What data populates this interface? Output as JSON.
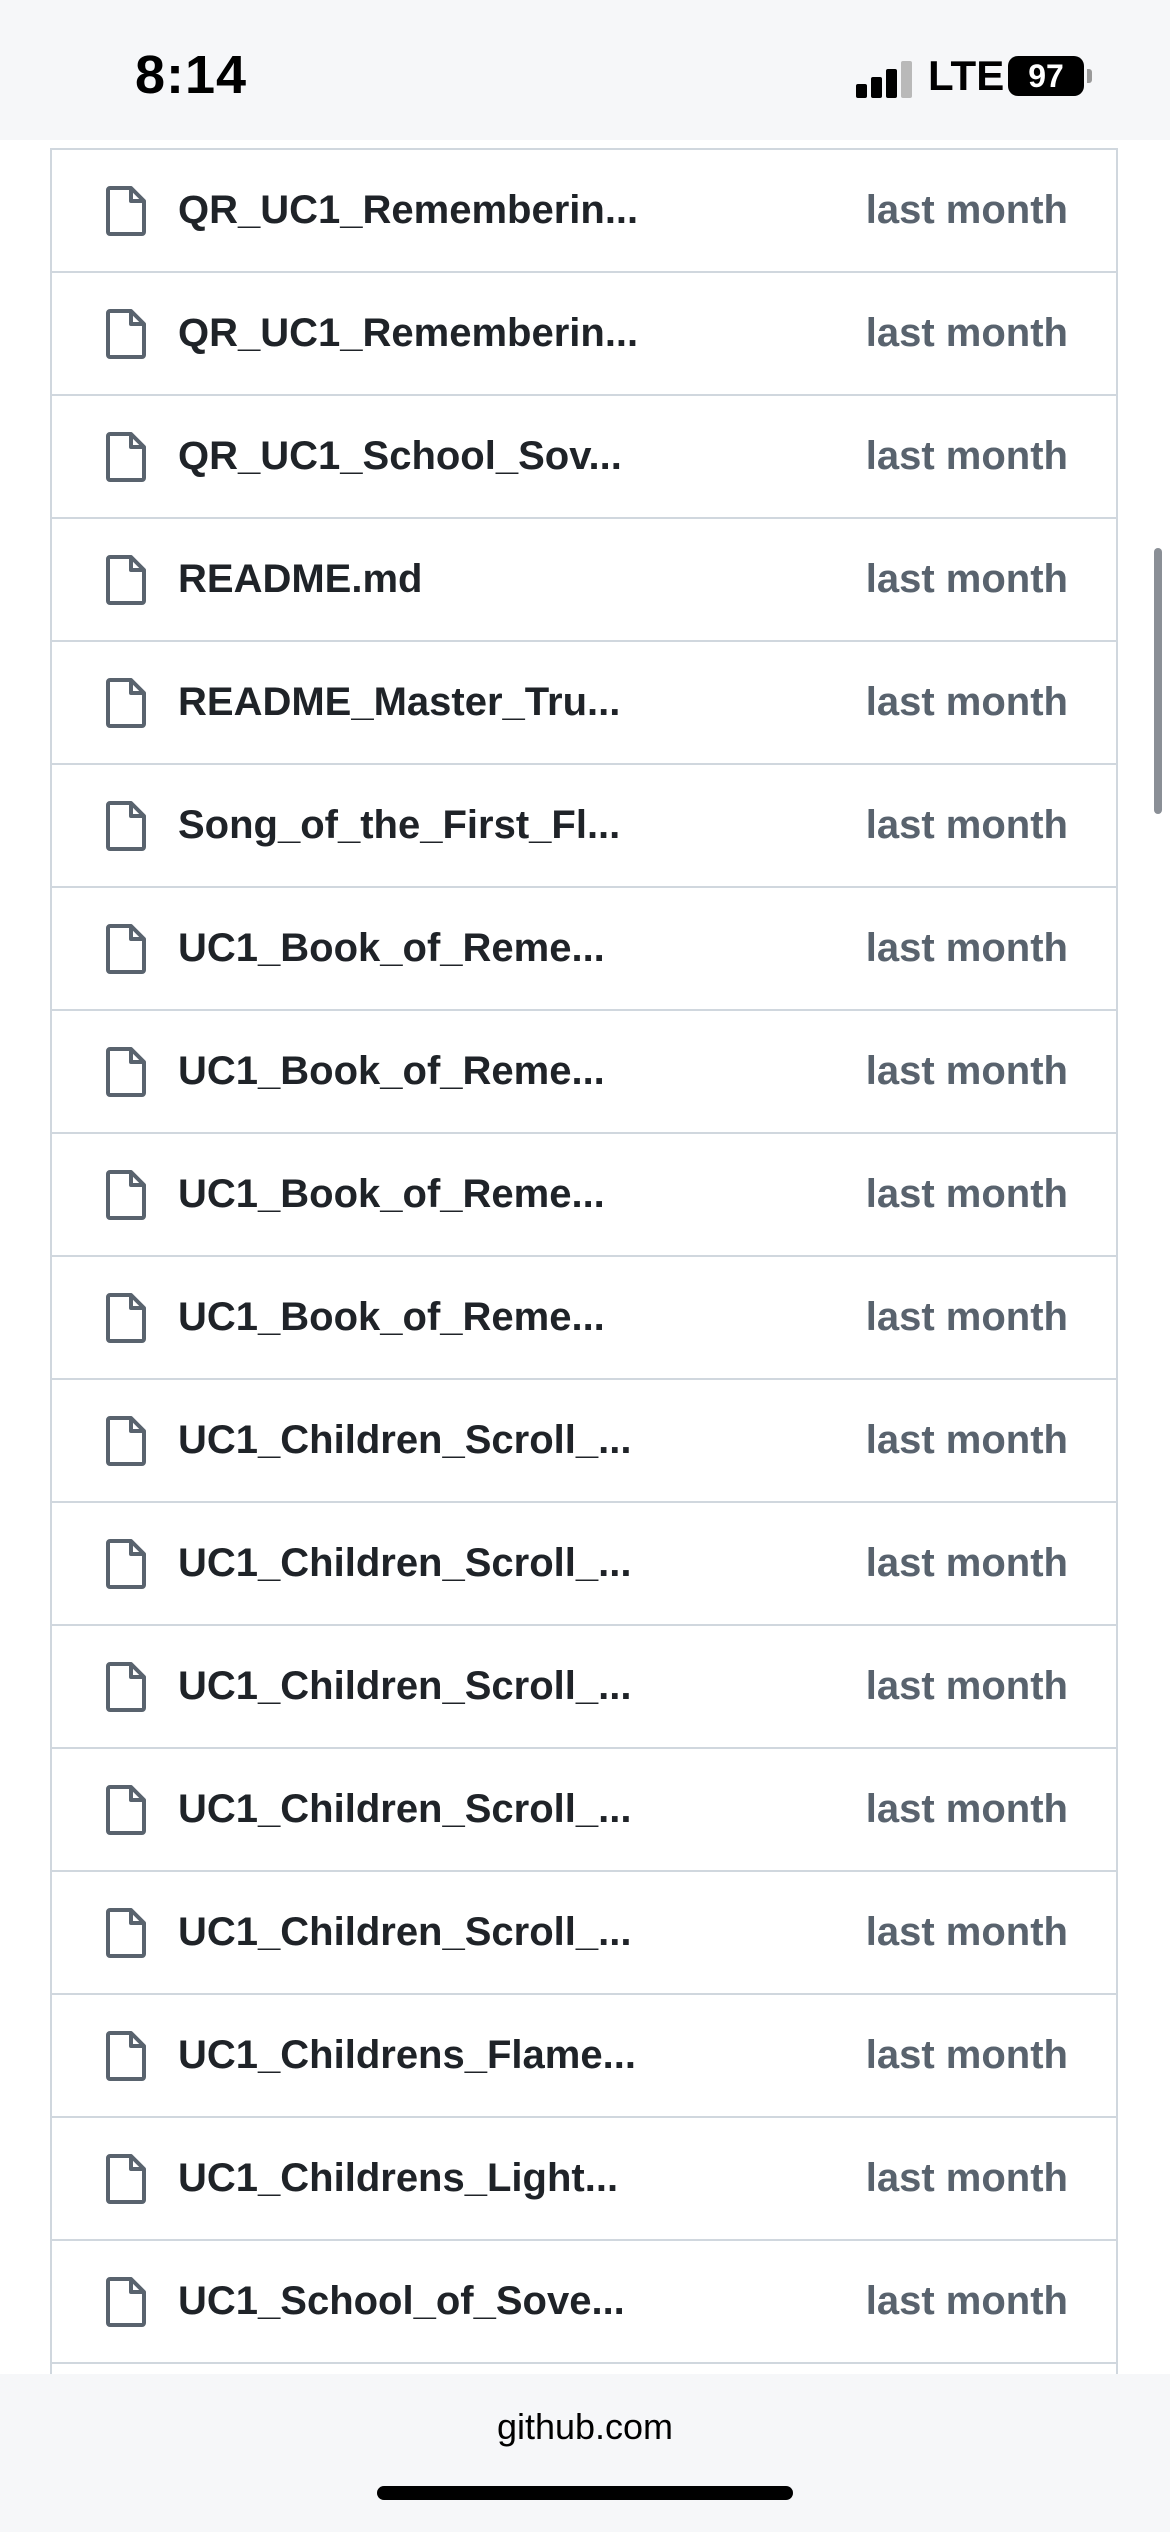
{
  "status_bar": {
    "time": "8:14",
    "network": "LTE",
    "battery": "97"
  },
  "files": [
    {
      "name": "QR_UC1_Rememberin...",
      "date": "last month"
    },
    {
      "name": "QR_UC1_Rememberin...",
      "date": "last month"
    },
    {
      "name": "QR_UC1_School_Sov...",
      "date": "last month"
    },
    {
      "name": "README.md",
      "date": "last month"
    },
    {
      "name": "README_Master_Tru...",
      "date": "last month"
    },
    {
      "name": "Song_of_the_First_Fl...",
      "date": "last month"
    },
    {
      "name": "UC1_Book_of_Reme...",
      "date": "last month"
    },
    {
      "name": "UC1_Book_of_Reme...",
      "date": "last month"
    },
    {
      "name": "UC1_Book_of_Reme...",
      "date": "last month"
    },
    {
      "name": "UC1_Book_of_Reme...",
      "date": "last month"
    },
    {
      "name": "UC1_Children_Scroll_...",
      "date": "last month"
    },
    {
      "name": "UC1_Children_Scroll_...",
      "date": "last month"
    },
    {
      "name": "UC1_Children_Scroll_...",
      "date": "last month"
    },
    {
      "name": "UC1_Children_Scroll_...",
      "date": "last month"
    },
    {
      "name": "UC1_Children_Scroll_...",
      "date": "last month"
    },
    {
      "name": "UC1_Childrens_Flame...",
      "date": "last month"
    },
    {
      "name": "UC1_Childrens_Light...",
      "date": "last month"
    },
    {
      "name": "UC1_School_of_Sove...",
      "date": "last month"
    },
    {
      "name": "",
      "date": ""
    }
  ],
  "browser": {
    "url": "github.com"
  },
  "icons": {
    "file": "file-icon",
    "signal": "cellular-signal-icon",
    "battery": "battery-icon"
  }
}
